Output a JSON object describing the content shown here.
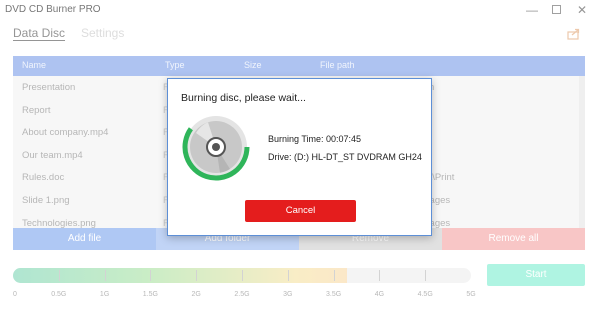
{
  "window": {
    "title": "DVD CD Burner PRO",
    "minimize": "—",
    "close": "✕"
  },
  "tabs": [
    {
      "label": "Data Disc",
      "active": true
    },
    {
      "label": "Settings",
      "active": false
    }
  ],
  "table": {
    "headers": {
      "name": "Name",
      "type": "Type",
      "size": "Size",
      "path": "File path"
    },
    "rows": [
      {
        "name": "Presentation",
        "type": "F",
        "path": "tion"
      },
      {
        "name": "Report",
        "type": "F",
        "path": "s"
      },
      {
        "name": "About company.mp4",
        "type": "F",
        "path": ""
      },
      {
        "name": "Our team.mp4",
        "type": "F",
        "path": ""
      },
      {
        "name": "Rules.doc",
        "type": "F",
        "path": "ant\\Print"
      },
      {
        "name": "Slide 1.png",
        "type": "F",
        "path": "Images"
      },
      {
        "name": "Technologies.png",
        "type": "F",
        "path": "Images"
      }
    ]
  },
  "actions": {
    "add_file": "Add file",
    "add_folder": "Add folder",
    "remove": "Remove",
    "remove_all": "Remove all"
  },
  "capacity": {
    "labels": [
      "0",
      "0.5G",
      "1G",
      "1.5G",
      "2G",
      "2.5G",
      "3G",
      "3.5G",
      "4G",
      "4.5G",
      "5G"
    ],
    "used_fraction": 0.73,
    "start": "Start"
  },
  "dialog": {
    "title": "Burning disc, please wait...",
    "time": "Burning Time: 00:07:45",
    "drive": "Drive: (D:) HL-DT_ST DVDRAM GH24",
    "cancel": "Cancel",
    "progress_fraction": 0.6
  },
  "colors": {
    "header": "#7d9fe8",
    "cancel": "#e41d1d",
    "progress": "#2fb55a",
    "modal_border": "#5d8fd6"
  },
  "icons": {
    "share": "share-icon",
    "disc": "disc-icon"
  }
}
